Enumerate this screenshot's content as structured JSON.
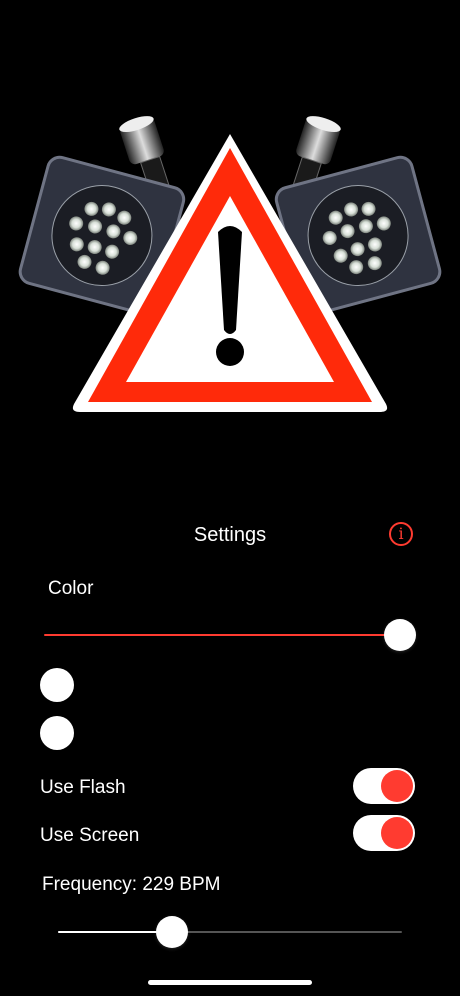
{
  "header": {
    "title": "Settings",
    "info_icon": "info-icon"
  },
  "controls": {
    "color_label": "Color",
    "color_level": 1.0,
    "use_flash_label": "Use Flash",
    "use_flash_on": true,
    "use_screen_label": "Use Screen",
    "use_screen_on": true,
    "frequency_label": "Frequency: 229 BPM",
    "frequency_level": 0.33
  },
  "colors": {
    "accent": "#ff3b30",
    "background": "#000000"
  }
}
